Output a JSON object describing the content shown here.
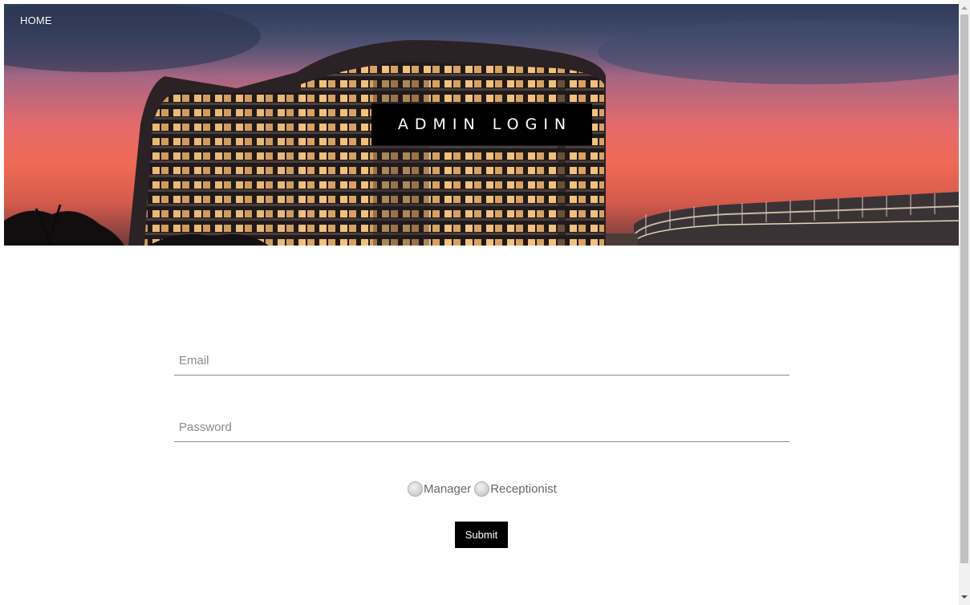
{
  "nav": {
    "home_label": "HOME"
  },
  "hero": {
    "title": "ADMIN LOGIN"
  },
  "form": {
    "email_placeholder": "Email",
    "password_placeholder": "Password",
    "roles": [
      "Manager",
      "Receptionist"
    ],
    "submit_label": "Submit"
  }
}
